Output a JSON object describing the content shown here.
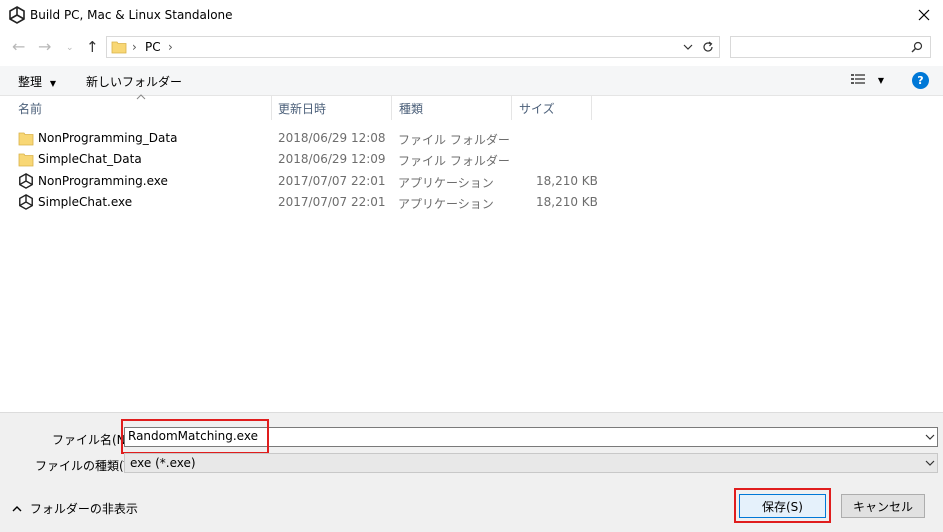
{
  "window": {
    "title": "Build PC, Mac & Linux Standalone"
  },
  "nav": {
    "breadcrumb_sep": "›",
    "breadcrumb_location": "PC",
    "breadcrumb_end": "›"
  },
  "command_bar": {
    "organize_label": "整理",
    "new_folder_label": "新しいフォルダー"
  },
  "columns": {
    "name": "名前",
    "date": "更新日時",
    "type": "種類",
    "size": "サイズ"
  },
  "files": [
    {
      "name": "NonProgramming_Data",
      "date": "2018/06/29 12:08",
      "type": "ファイル フォルダー",
      "size": "",
      "icon": "folder-icon"
    },
    {
      "name": "SimpleChat_Data",
      "date": "2018/06/29 12:09",
      "type": "ファイル フォルダー",
      "size": "",
      "icon": "folder-icon"
    },
    {
      "name": "NonProgramming.exe",
      "date": "2017/07/07 22:01",
      "type": "アプリケーション",
      "size": "18,210 KB",
      "icon": "unity-app-icon"
    },
    {
      "name": "SimpleChat.exe",
      "date": "2017/07/07 22:01",
      "type": "アプリケーション",
      "size": "18,210 KB",
      "icon": "unity-app-icon"
    }
  ],
  "bottom": {
    "filename_label": "ファイル名(N):",
    "filename_value": "RandomMatching.exe",
    "filetype_label": "ファイルの種類(T):",
    "filetype_value": "exe (*.exe)",
    "hide_folders_label": "フォルダーの非表示",
    "save_label": "保存(S)",
    "cancel_label": "キャンセル"
  },
  "colors": {
    "highlight": "#e01d1d",
    "accent": "#0078d7",
    "folder": "#f8d775"
  }
}
